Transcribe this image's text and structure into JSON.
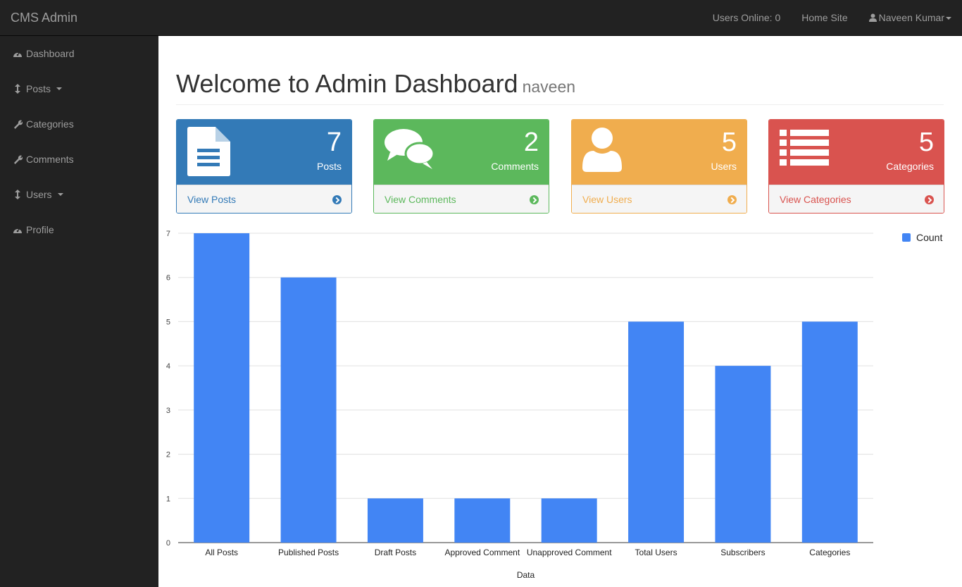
{
  "topbar": {
    "brand": "CMS Admin",
    "users_online": "Users Online: 0",
    "home_site": "Home Site",
    "user_name": "Naveen Kumar"
  },
  "sidebar": {
    "items": [
      {
        "label": "Dashboard",
        "icon": "dashboard-icon"
      },
      {
        "label": "Posts",
        "icon": "arrows-v-icon",
        "dropdown": true
      },
      {
        "label": "Categories",
        "icon": "wrench-icon"
      },
      {
        "label": "Comments",
        "icon": "wrench-icon"
      },
      {
        "label": "Users",
        "icon": "arrows-v-icon",
        "dropdown": true
      },
      {
        "label": "Profile",
        "icon": "dashboard-icon"
      }
    ]
  },
  "header": {
    "title": "Welcome to Admin Dashboard",
    "subtitle": "naveen"
  },
  "cards": [
    {
      "count": "7",
      "label": "Posts",
      "link": "View Posts",
      "color": "#337ab7",
      "icon": "file-text-icon"
    },
    {
      "count": "2",
      "label": "Comments",
      "link": "View Comments",
      "color": "#5cb85c",
      "icon": "comments-icon"
    },
    {
      "count": "5",
      "label": "Users",
      "link": "View Users",
      "color": "#f0ad4e",
      "icon": "user-icon"
    },
    {
      "count": "5",
      "label": "Categories",
      "link": "View Categories",
      "color": "#d9534f",
      "icon": "list-icon"
    }
  ],
  "chart_data": {
    "type": "bar",
    "categories": [
      "All Posts",
      "Published Posts",
      "Draft Posts",
      "Approved Comment",
      "Unapproved Comment",
      "Total Users",
      "Subscribers",
      "Categories"
    ],
    "series": [
      {
        "name": "Count",
        "values": [
          7,
          6,
          1,
          1,
          1,
          5,
          4,
          5
        ],
        "color": "#4285f4"
      }
    ],
    "xlabel": "Data",
    "ylabel": "",
    "ylim": [
      0,
      7
    ],
    "yticks": [
      0,
      1,
      2,
      3,
      4,
      5,
      6,
      7
    ],
    "grid": true,
    "legend": "top-right"
  }
}
